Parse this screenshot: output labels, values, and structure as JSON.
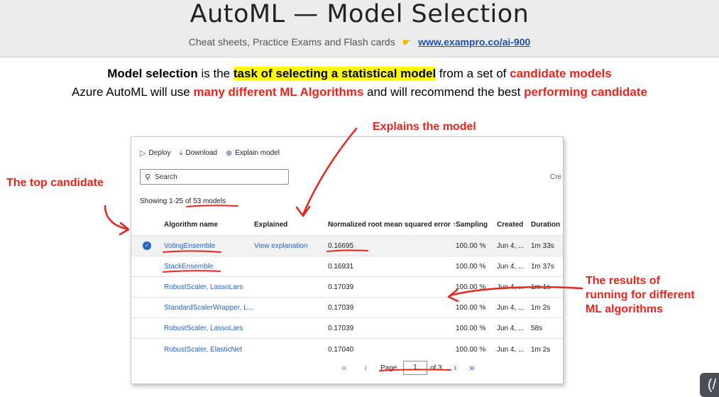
{
  "slide": {
    "title": "AutoML — Model Selection",
    "subline_text": "Cheat sheets, Practice Exams and Flash cards",
    "subline_link": "www.exampro.co/ai-900"
  },
  "intro": {
    "l1_a": "Model selection",
    "l1_b": " is the ",
    "l1_c": "task of selecting a statistical model",
    "l1_d": " from a set of ",
    "l1_e": "candidate models",
    "l2_a": "Azure AutoML will use ",
    "l2_b": "many different ML Algorithms",
    "l2_c": " and will recommend the best ",
    "l2_d": "performing candidate"
  },
  "annotations": {
    "explains": "Explains the model",
    "top_candidate": "The top candidate",
    "results_l1": "The results of",
    "results_l2": "running for different",
    "results_l3": "ML algorithms"
  },
  "panel": {
    "toolbar": {
      "deploy": "Deploy",
      "download": "Download",
      "explain": "Explain model"
    },
    "search_placeholder": "Search",
    "created_cut": "Cre",
    "showing_a": "Showing 1-25 of ",
    "showing_b": "53 models",
    "columns": {
      "algorithm": "Algorithm name",
      "explained": "Explained",
      "nrmse": "Normalized root mean squared error ↑",
      "sampling": "Sampling",
      "created": "Created",
      "duration": "Duration"
    },
    "rows": [
      {
        "name": "VotingEnsemble",
        "explained": "View explanation",
        "error": "0.16695",
        "sampling": "100.00 %",
        "created": "Jun 4, ...",
        "duration": "1m 33s"
      },
      {
        "name": "StackEnsemble",
        "explained": "",
        "error": "0.16931",
        "sampling": "100.00 %",
        "created": "Jun 4, ...",
        "duration": "1m 37s"
      },
      {
        "name": "RobustScaler, LassoLars",
        "explained": "",
        "error": "0.17039",
        "sampling": "100.00 %",
        "created": "Jun 4, ...",
        "duration": "1m 1s"
      },
      {
        "name": "StandardScalerWrapper, L...",
        "explained": "",
        "error": "0.17039",
        "sampling": "100.00 %",
        "created": "Jun 4, ...",
        "duration": "1m 2s"
      },
      {
        "name": "RobustScaler, LassoLars",
        "explained": "",
        "error": "0.17039",
        "sampling": "100.00 %",
        "created": "Jun 4, ...",
        "duration": "58s"
      },
      {
        "name": "RobustScaler, ElasticNet",
        "explained": "",
        "error": "0.17040",
        "sampling": "100.00 %",
        "created": "Jun 4, ...",
        "duration": "1m 2s"
      }
    ],
    "pager": {
      "page_label": "Page",
      "page_value": "1",
      "of_label": "of 3"
    }
  },
  "colors": {
    "accent": "#2563c9",
    "annotation": "#e8251c",
    "highlight": "#ffff00",
    "header_bg": "#ececec"
  }
}
